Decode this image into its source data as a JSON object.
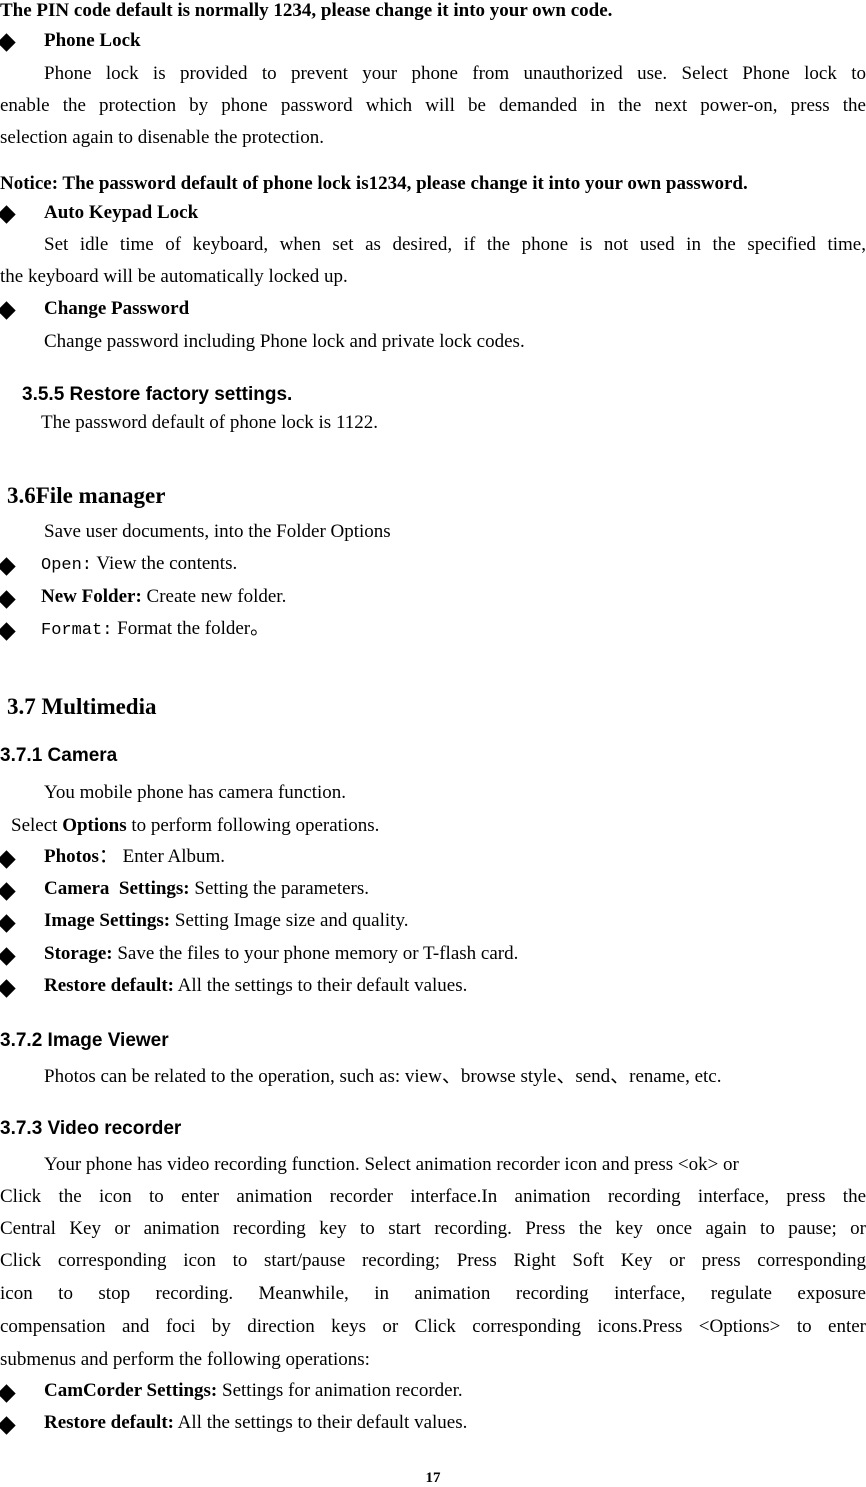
{
  "pin_notice": "The PIN code default is normally 1234, please change it into your own code.",
  "security": {
    "phone_lock": {
      "title": "Phone Lock",
      "lines": [
        "Phone lock is provided to prevent your phone from unauthorized use. Select Phone lock to",
        "enable the protection by phone password which will be demanded in the next power-on, press the",
        "selection again to disenable the protection."
      ]
    },
    "notice": "Notice: The password default of phone lock is1234, please change it into your own password.",
    "auto_keypad_lock": {
      "title": "Auto Keypad Lock",
      "lines": [
        "Set idle time of keyboard, when set as desired, if the phone is not used in the specified time,",
        "the keyboard will be automatically locked up."
      ]
    },
    "change_password": {
      "title": "Change Password",
      "text": "Change password including Phone lock and private lock codes."
    }
  },
  "restore_factory": {
    "heading": "3.5.5 Restore factory settings.",
    "text": "The password default of phone lock is 1122."
  },
  "file_manager": {
    "heading": "3.6File manager",
    "intro": "Save user documents, into the Folder Options",
    "items": [
      {
        "label": "Open:",
        "text": " View the contents."
      },
      {
        "label": "New Folder:",
        "text": " Create new folder."
      },
      {
        "label": "Format:",
        "text": " Format the folder。"
      }
    ]
  },
  "multimedia": {
    "heading": "3.7 Multimedia",
    "camera": {
      "heading": "3.7.1 Camera",
      "intro": "You mobile phone has camera function.",
      "select_prefix": "Select ",
      "select_bold": "Options",
      "select_suffix": " to perform following operations.",
      "items": [
        {
          "label": "Photos",
          "text": "： Enter Album."
        },
        {
          "label": "Camera  Settings:",
          "text": " Setting the parameters."
        },
        {
          "label": "Image Settings:",
          "text": " Setting Image size and quality."
        },
        {
          "label": "Storage:",
          "text": " Save the files to your phone memory or T-flash card."
        },
        {
          "label": "Restore default:",
          "text": " All the settings to their default values."
        }
      ]
    },
    "image_viewer": {
      "heading": "3.7.2 Image Viewer",
      "text": "Photos can be related to the operation, such as: view、browse style、send、rename, etc."
    },
    "video_recorder": {
      "heading": "3.7.3 Video recorder",
      "lines": [
        "Your phone has video recording function. Select animation recorder icon and press <ok> or",
        "Click the icon to enter animation recorder interface.In animation recording interface, press the",
        "Central Key or animation recording key to start recording. Press the key once again to pause; or",
        "Click corresponding icon to start/pause recording; Press Right Soft Key or press corresponding",
        "icon to stop recording. Meanwhile, in animation recording interface, regulate exposure",
        "compensation and foci by direction keys or Click corresponding icons.Press <Options> to enter",
        "submenus and perform the following operations:"
      ],
      "items": [
        {
          "label": "CamCorder Settings:",
          "text": " Settings for animation recorder."
        },
        {
          "label": "Restore default:",
          "text": " All the settings to their default values."
        }
      ]
    }
  },
  "page_number": "17"
}
